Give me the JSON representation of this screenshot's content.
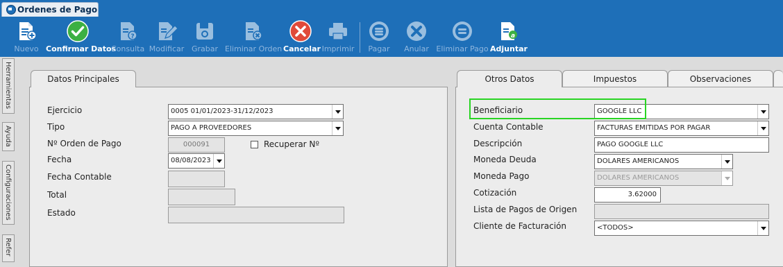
{
  "window": {
    "title": "Ordenes de Pago"
  },
  "toolbar": {
    "nuevo": "Nuevo",
    "confirmar": "Confirmar Datos",
    "consulta": "Consulta",
    "modificar": "Modificar",
    "grabar": "Grabar",
    "eliminar_orden": "Eliminar Orden",
    "cancelar": "Cancelar",
    "imprimir": "Imprimir",
    "pagar": "Pagar",
    "anular": "Anular",
    "eliminar_pago": "Eliminar Pago",
    "adjuntar": "Adjuntar"
  },
  "sidebar": {
    "tabs": [
      "Herramientas",
      "Ayuda",
      "Configuraciones",
      "Refer"
    ]
  },
  "left_panel": {
    "tab": "Datos Principales",
    "labels": {
      "ejercicio": "Ejercicio",
      "tipo": "Tipo",
      "numero": "Nº Orden de Pago",
      "fecha": "Fecha",
      "fecha_contable": "Fecha Contable",
      "total": "Total",
      "estado": "Estado"
    },
    "values": {
      "ejercicio": "0005 01/01/2023-31/12/2023",
      "tipo": "PAGO A PROVEEDORES",
      "numero": "000091",
      "fecha": "08/08/2023",
      "fecha_contable": "",
      "total": "",
      "estado": ""
    },
    "recuperar_label": "Recuperar Nº"
  },
  "right_panel": {
    "tabs": [
      "Otros Datos",
      "Impuestos",
      "Observaciones"
    ],
    "labels": {
      "beneficiario": "Beneficiario",
      "cuenta_contable": "Cuenta Contable",
      "descripcion": "Descripción",
      "moneda_deuda": "Moneda Deuda",
      "moneda_pago": "Moneda Pago",
      "cotizacion": "Cotización",
      "lista_pagos": "Lista de Pagos de Origen",
      "cliente_facturacion": "Cliente de Facturación"
    },
    "values": {
      "beneficiario": "GOOGLE LLC",
      "cuenta_contable": "FACTURAS EMITIDAS POR PAGAR",
      "descripcion": "PAGO GOOGLE LLC",
      "moneda_deuda": "DOLARES AMERICANOS",
      "moneda_pago": "DOLARES AMERICANOS",
      "cotizacion": "3.62000",
      "lista_pagos": "",
      "cliente_facturacion": "<TODOS>"
    }
  },
  "colors": {
    "toolbar_bg": "#1e6fb8",
    "highlight": "#28d422",
    "confirm_green": "#3cb043",
    "cancel_red": "#e04a3a"
  }
}
